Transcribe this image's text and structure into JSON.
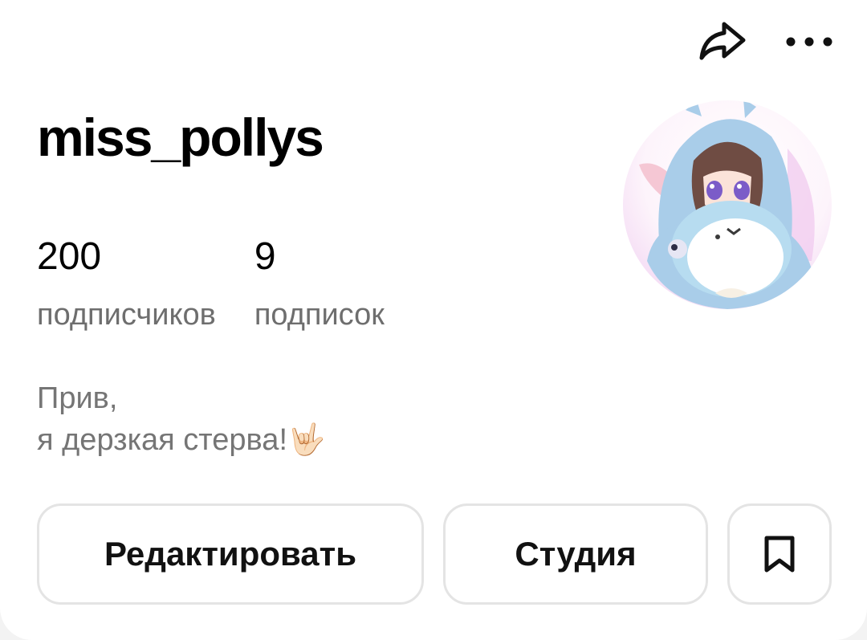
{
  "header": {
    "share_icon": "share-arrow-icon",
    "more_icon": "more-horizontal-icon"
  },
  "profile": {
    "username": "miss_pollys",
    "avatar_icon": "anime-girl-with-bunny-avatar",
    "stats": {
      "followers_count": "200",
      "followers_label": "подписчиков",
      "following_count": "9",
      "following_label": "подписок"
    },
    "bio": {
      "line1": "Прив,",
      "line2": "я дерзкая стерва!🤟🏻"
    }
  },
  "actions": {
    "edit_label": "Редактировать",
    "studio_label": "Студия",
    "saved_icon": "bookmark-icon"
  }
}
